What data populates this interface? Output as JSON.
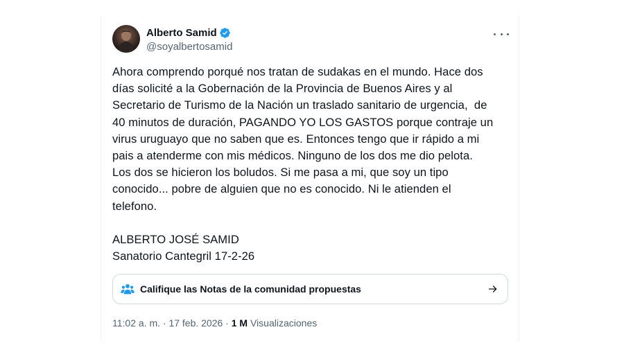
{
  "author": {
    "display_name": "Alberto Samid",
    "handle": "@soyalbertosamid",
    "verified_icon": "verified-badge-icon",
    "verified_color": "#1d9bf0"
  },
  "menu_icon": "more-options-icon",
  "tweet": {
    "text": "Ahora comprendo porqué nos tratan de sudakas en el mundo. Hace dos\ndías solicité a la Gobernación de la Provincia de Buenos Aires y al\nSecretario de Turismo de la Nación un traslado sanitario de urgencia,  de\n40 minutos de duración, PAGANDO YO LOS GASTOS porque contraje un\nvirus uruguayo que no saben que es. Entonces tengo que ir rápido a mi\npais a atenderme con mis médicos. Ninguno de los dos me dio pelota.\nLos dos se hicieron los boludos. Si me pasa a mi, que soy un tipo\nconocido... pobre de alguien que no es conocido. Ni le atienden el\ntelefono.\n\nALBERTO JOSÉ SAMID\nSanatorio Cantegril 17-2-26"
  },
  "community_notes": {
    "icon": "people-icon",
    "icon_color": "#1d9bf0",
    "label": "Califique las Notas de la comunidad propuestas",
    "arrow_icon": "arrow-right-icon"
  },
  "meta": {
    "timestamp": "11:02 a. m. · 17 feb. 2026",
    "separator": " · ",
    "views_count": "1 M",
    "views_label": "Visualizaciones"
  }
}
